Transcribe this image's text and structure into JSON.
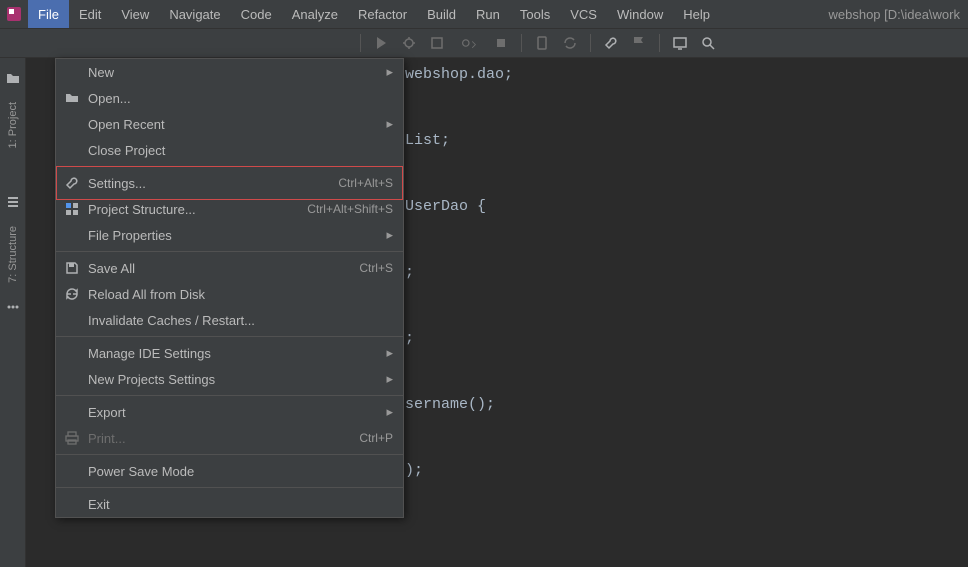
{
  "menubar": {
    "items": [
      "File",
      "Edit",
      "View",
      "Navigate",
      "Code",
      "Analyze",
      "Refactor",
      "Build",
      "Run",
      "Tools",
      "VCS",
      "Window",
      "Help"
    ],
    "project_path": "webshop [D:\\idea\\work"
  },
  "leftbar": {
    "project_label": "1: Project",
    "structure_label": "7: Structure"
  },
  "code": {
    "line1_suffix": ".webshop.dao",
    "line2_suffix": ".List",
    "line3_prefix": " UserDao ",
    "line4": ");",
    "line5": ");",
    "line6": "Username()",
    "line7": "()"
  },
  "dropdown": {
    "items": [
      {
        "label": "New",
        "has_arrow": true
      },
      {
        "label": "Open...",
        "icon": "folder"
      },
      {
        "label": "Open Recent",
        "has_arrow": true
      },
      {
        "label": "Close Project"
      },
      {
        "sep": true
      },
      {
        "label": "Settings...",
        "shortcut": "Ctrl+Alt+S",
        "icon": "wrench",
        "highlighted": true
      },
      {
        "label": "Project Structure...",
        "shortcut": "Ctrl+Alt+Shift+S",
        "icon": "project-structure"
      },
      {
        "label": "File Properties",
        "has_arrow": true
      },
      {
        "sep": true
      },
      {
        "label": "Save All",
        "shortcut": "Ctrl+S",
        "icon": "save"
      },
      {
        "label": "Reload All from Disk",
        "icon": "reload"
      },
      {
        "label": "Invalidate Caches / Restart..."
      },
      {
        "sep": true
      },
      {
        "label": "Manage IDE Settings",
        "has_arrow": true
      },
      {
        "label": "New Projects Settings",
        "has_arrow": true
      },
      {
        "sep": true
      },
      {
        "label": "Export",
        "has_arrow": true
      },
      {
        "label": "Print...",
        "shortcut": "Ctrl+P",
        "icon": "print",
        "disabled": true
      },
      {
        "sep": true
      },
      {
        "label": "Power Save Mode"
      },
      {
        "sep": true
      },
      {
        "label": "Exit"
      }
    ]
  }
}
